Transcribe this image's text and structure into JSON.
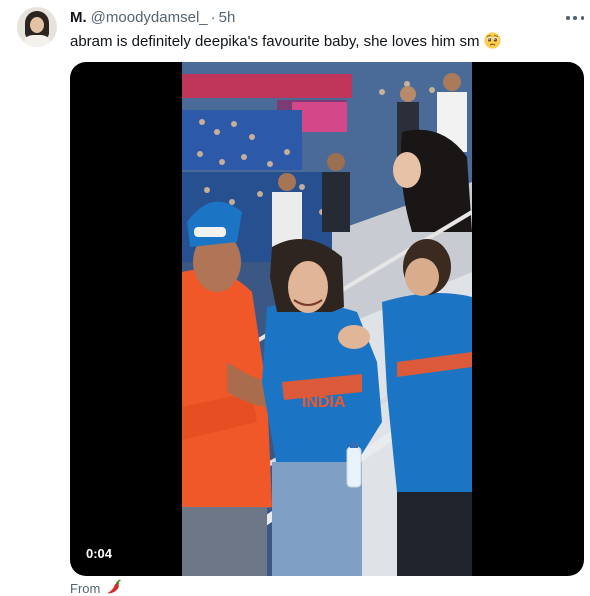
{
  "tweet": {
    "author_name": "M.",
    "author_handle": "@moodydamsel_",
    "separator": "·",
    "time": "5h",
    "text": "abram is definitely deepika's favourite baby, she loves him sm",
    "text_emoji": "pleading-face-emoji",
    "video": {
      "duration": "0:04"
    },
    "attribution_label": "From",
    "attribution_icon": "chili-pepper-emoji"
  },
  "colors": {
    "primary_text": "#0f1419",
    "secondary_text": "#536471",
    "media_background": "#000000",
    "jersey_blue": "#1c74c4",
    "jersey_orange": "#f0582a"
  }
}
